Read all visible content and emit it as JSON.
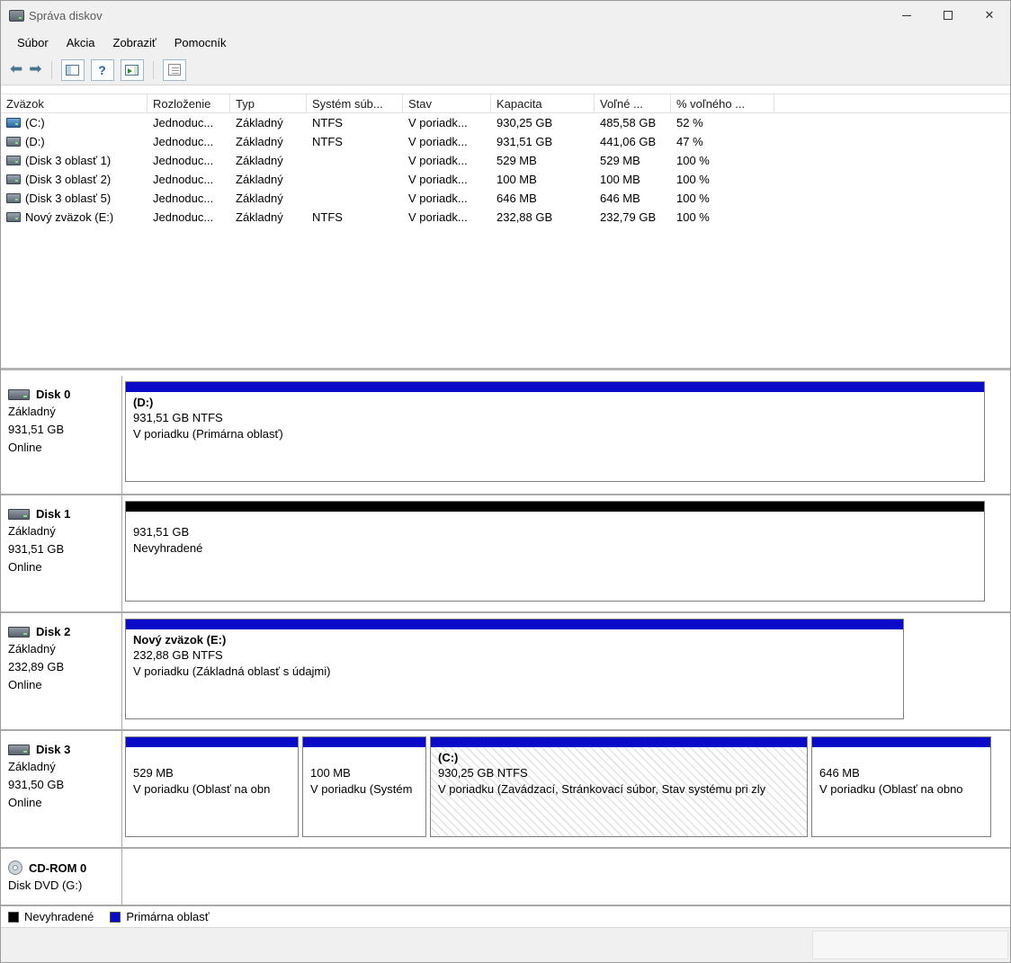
{
  "window": {
    "title": "Správa diskov",
    "controls": {
      "close_glyph": "✕"
    }
  },
  "menu": {
    "items": [
      {
        "label": "Súbor"
      },
      {
        "label": "Akcia"
      },
      {
        "label": "Zobraziť"
      },
      {
        "label": "Pomocník"
      }
    ]
  },
  "toolbar": {
    "icons": [
      {
        "name": "back-arrow",
        "glyph": "⬅"
      },
      {
        "name": "forward-arrow",
        "glyph": "➡"
      },
      {
        "name": "console-tree"
      },
      {
        "name": "help",
        "glyph": "?"
      },
      {
        "name": "show-action-pane"
      },
      {
        "name": "properties"
      }
    ]
  },
  "volume_table": {
    "columns": [
      {
        "label": "Zväzok"
      },
      {
        "label": "Rozloženie"
      },
      {
        "label": "Typ"
      },
      {
        "label": "Systém súb..."
      },
      {
        "label": "Stav"
      },
      {
        "label": "Kapacita"
      },
      {
        "label": "Voľné ..."
      },
      {
        "label": "% voľného ..."
      }
    ],
    "rows": [
      {
        "volume": "(C:)",
        "layout": "Jednoduc...",
        "type": "Základný",
        "filesystem": "NTFS",
        "status": "V poriadk...",
        "capacity": "930,25 GB",
        "free": "485,58 GB",
        "free_pct": "52 %"
      },
      {
        "volume": "(D:)",
        "layout": "Jednoduc...",
        "type": "Základný",
        "filesystem": "NTFS",
        "status": "V poriadk...",
        "capacity": "931,51 GB",
        "free": "441,06 GB",
        "free_pct": "47 %"
      },
      {
        "volume": "(Disk 3 oblasť 1)",
        "layout": "Jednoduc...",
        "type": "Základný",
        "filesystem": "",
        "status": "V poriadk...",
        "capacity": "529 MB",
        "free": "529 MB",
        "free_pct": "100 %"
      },
      {
        "volume": "(Disk 3 oblasť 2)",
        "layout": "Jednoduc...",
        "type": "Základný",
        "filesystem": "",
        "status": "V poriadk...",
        "capacity": "100 MB",
        "free": "100 MB",
        "free_pct": "100 %"
      },
      {
        "volume": "(Disk 3 oblasť 5)",
        "layout": "Jednoduc...",
        "type": "Základný",
        "filesystem": "",
        "status": "V poriadk...",
        "capacity": "646 MB",
        "free": "646 MB",
        "free_pct": "100 %"
      },
      {
        "volume": "Nový zväzok (E:)",
        "layout": "Jednoduc...",
        "type": "Základný",
        "filesystem": "NTFS",
        "status": "V poriadk...",
        "capacity": "232,88 GB",
        "free": "232,79 GB",
        "free_pct": "100 %"
      }
    ]
  },
  "disks": [
    {
      "name": "Disk 0",
      "type": "Základný",
      "size": "931,51 GB",
      "status": "Online",
      "partitions": [
        {
          "title": "(D:)",
          "size_line": "931,51 GB NTFS",
          "status_line": "V poriadku (Primárna oblasť)",
          "kind": "primary"
        }
      ]
    },
    {
      "name": "Disk 1",
      "type": "Základný",
      "size": "931,51 GB",
      "status": "Online",
      "partitions": [
        {
          "title": "",
          "size_line": "931,51 GB",
          "status_line": "Nevyhradené",
          "kind": "unallocated"
        }
      ]
    },
    {
      "name": "Disk 2",
      "type": "Základný",
      "size": "232,89 GB",
      "status": "Online",
      "partitions": [
        {
          "title": "Nový zväzok (E:)",
          "size_line": "232,88 GB NTFS",
          "status_line": "V poriadku (Základná oblasť s údajmi)",
          "kind": "primary"
        }
      ]
    },
    {
      "name": "Disk 3",
      "type": "Základný",
      "size": "931,50 GB",
      "status": "Online",
      "partitions": [
        {
          "title": "",
          "size_line": "529 MB",
          "status_line": "V poriadku (Oblasť na obn",
          "kind": "primary"
        },
        {
          "title": "",
          "size_line": "100 MB",
          "status_line": "V poriadku (Systém",
          "kind": "primary"
        },
        {
          "title": "(C:)",
          "size_line": "930,25 GB NTFS",
          "status_line": "V poriadku (Zavádzací, Stránkovací súbor, Stav systému pri zly",
          "kind": "primary",
          "selected": true
        },
        {
          "title": "",
          "size_line": "646 MB",
          "status_line": "V poriadku (Oblasť na obno",
          "kind": "primary"
        }
      ]
    }
  ],
  "cdrom": {
    "name": "CD-ROM 0",
    "media": "Disk DVD (G:)"
  },
  "legend": {
    "items": [
      {
        "label": "Nevyhradené",
        "color": "#000000"
      },
      {
        "label": "Primárna oblasť",
        "color": "#0a0ac8"
      }
    ]
  },
  "colors": {
    "primary_partition": "#0a0ac8",
    "unallocated": "#000000"
  }
}
